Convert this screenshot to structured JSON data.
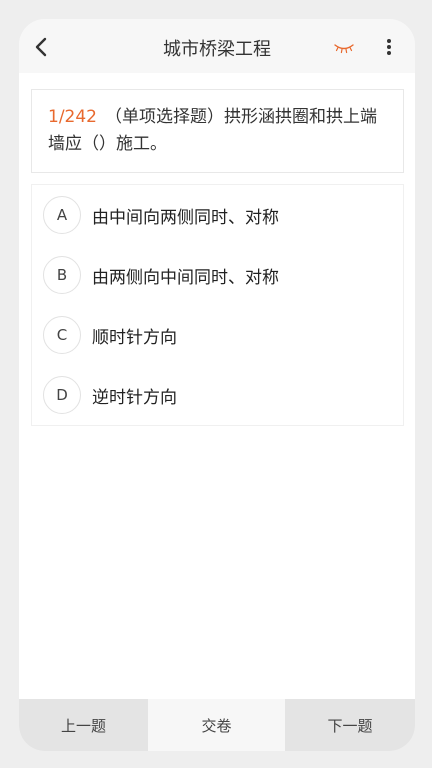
{
  "header": {
    "title": "城市桥梁工程",
    "back_icon": "chevron-left-icon",
    "eye_icon": "eye-closed-icon",
    "more_icon": "more-vertical-icon",
    "eye_color": "#e8692e"
  },
  "question": {
    "index": "1/242",
    "text": "（单项选择题）拱形涵拱圈和拱上端墙应（）施工。"
  },
  "options": [
    {
      "letter": "A",
      "text": "由中间向两侧同时、对称"
    },
    {
      "letter": "B",
      "text": "由两侧向中间同时、对称"
    },
    {
      "letter": "C",
      "text": "顺时针方向"
    },
    {
      "letter": "D",
      "text": "逆时针方向"
    }
  ],
  "footer": {
    "prev_label": "上一题",
    "submit_label": "交卷",
    "next_label": "下一题"
  }
}
